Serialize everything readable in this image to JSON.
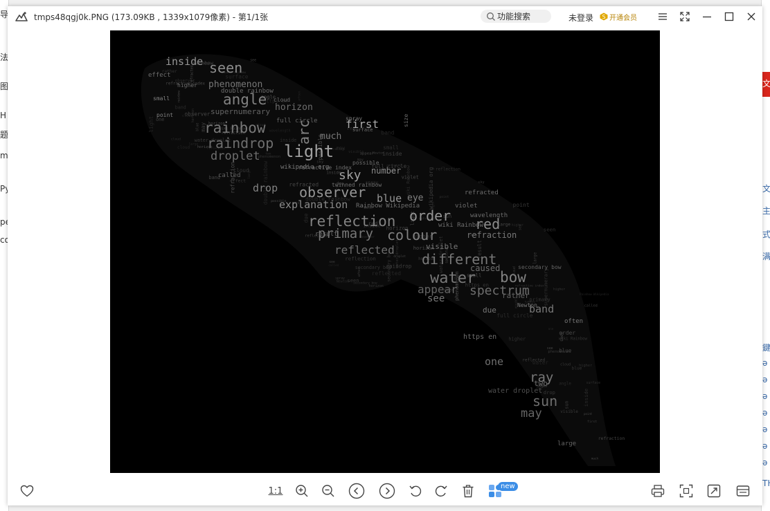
{
  "background": {
    "left_fragments": [
      "导",
      "法",
      "图",
      "H",
      "题",
      "ma",
      "Py",
      "pe",
      "co"
    ],
    "right_fragments": [
      "文",
      "文",
      "主",
      "式",
      "满",
      "鍵",
      "ə",
      "ə",
      "ə",
      "ə",
      "ə",
      "ə",
      "ə",
      "TH"
    ]
  },
  "titlebar": {
    "file_title": "tmps48qgj0k.PNG (173.09KB , 1339x1079像素) - 第1/1张",
    "search_placeholder": "功能搜索",
    "login_label": "未登录",
    "vip_label": "开通会员"
  },
  "toolbar": {
    "actual_size_label": "1:1",
    "new_badge": "new"
  },
  "colors": {
    "accent_blue": "#3b8de6",
    "vip_gold": "#e0a800",
    "image_background": "#000000"
  },
  "image": {
    "wordcloud_words": [
      "inside",
      "seen",
      "effect",
      "phenomenon",
      "angle",
      "double rainbow",
      "higher",
      "small",
      "horizon",
      "supernumerary",
      "cloud",
      "point",
      "rainbow",
      "full circle",
      "raindrop",
      "arc",
      "first",
      "spray",
      "much",
      "droplet",
      "light",
      "wikipedia org",
      "possible",
      "called",
      "sky",
      "number",
      "observer",
      "drop",
      "blue",
      "eye",
      "explanation",
      "reflection",
      "order",
      "red",
      "primary",
      "colour",
      "refraction",
      "reflected",
      "visible",
      "different",
      "water",
      "bow",
      "appear",
      "spectrum",
      "see",
      "band",
      "due",
      "Newton",
      "often",
      "https en",
      "one",
      "ray",
      "two",
      "sun",
      "water droplet",
      "may",
      "large",
      "violet",
      "refracted",
      "wavelength",
      "Rainbow Wikipedia",
      "wiki Rainbow",
      "twinned rainbow",
      "secondary bow",
      "caused",
      "size",
      "surface",
      "result",
      "refractive index",
      "rather",
      "Wikipedia https"
    ]
  }
}
